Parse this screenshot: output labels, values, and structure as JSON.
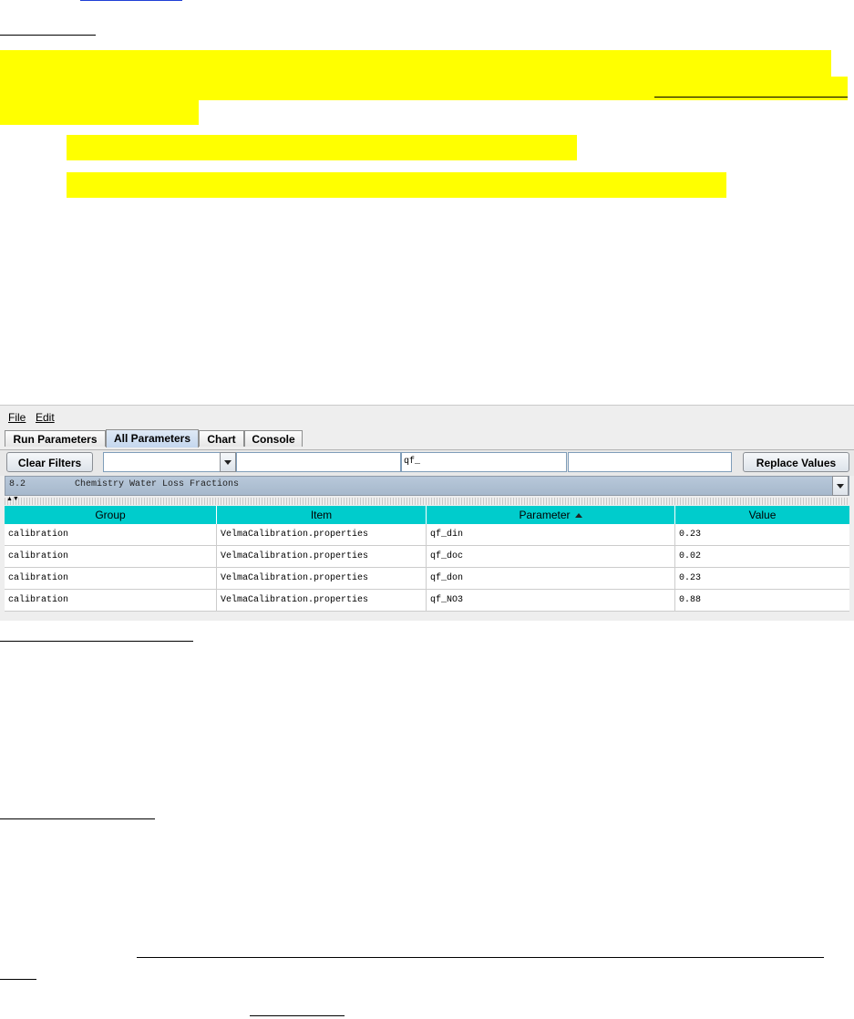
{
  "app": {
    "menu": {
      "file": "File",
      "edit": "Edit"
    },
    "tabs": [
      {
        "label": "Run Parameters",
        "active": false
      },
      {
        "label": "All Parameters",
        "active": true
      },
      {
        "label": "Chart",
        "active": false
      },
      {
        "label": "Console",
        "active": false
      }
    ],
    "toolbar": {
      "clear_filters_label": "Clear Filters",
      "group_filter_value": "",
      "item_filter_value": "",
      "parameter_filter_value": "qf_",
      "value_filter_value": "",
      "replace_values_label": "Replace Values"
    },
    "section_select": {
      "number": "8.2",
      "name": "Chemistry Water Loss Fractions"
    },
    "table": {
      "columns": [
        "Group",
        "Item",
        "Parameter",
        "Value"
      ],
      "sorted_column": "Parameter",
      "rows": [
        {
          "group": "calibration",
          "item": "VelmaCalibration.properties",
          "parameter": "qf_din",
          "value": "0.23"
        },
        {
          "group": "calibration",
          "item": "VelmaCalibration.properties",
          "parameter": "qf_doc",
          "value": "0.02"
        },
        {
          "group": "calibration",
          "item": "VelmaCalibration.properties",
          "parameter": "qf_don",
          "value": "0.23"
        },
        {
          "group": "calibration",
          "item": "VelmaCalibration.properties",
          "parameter": "qf_NO3",
          "value": "0.88"
        }
      ]
    }
  },
  "colors": {
    "highlight": "#ffff00",
    "header_bg": "#00cccc",
    "section_bg": "#aabbcf",
    "active_tab": "#c4d7ee"
  }
}
